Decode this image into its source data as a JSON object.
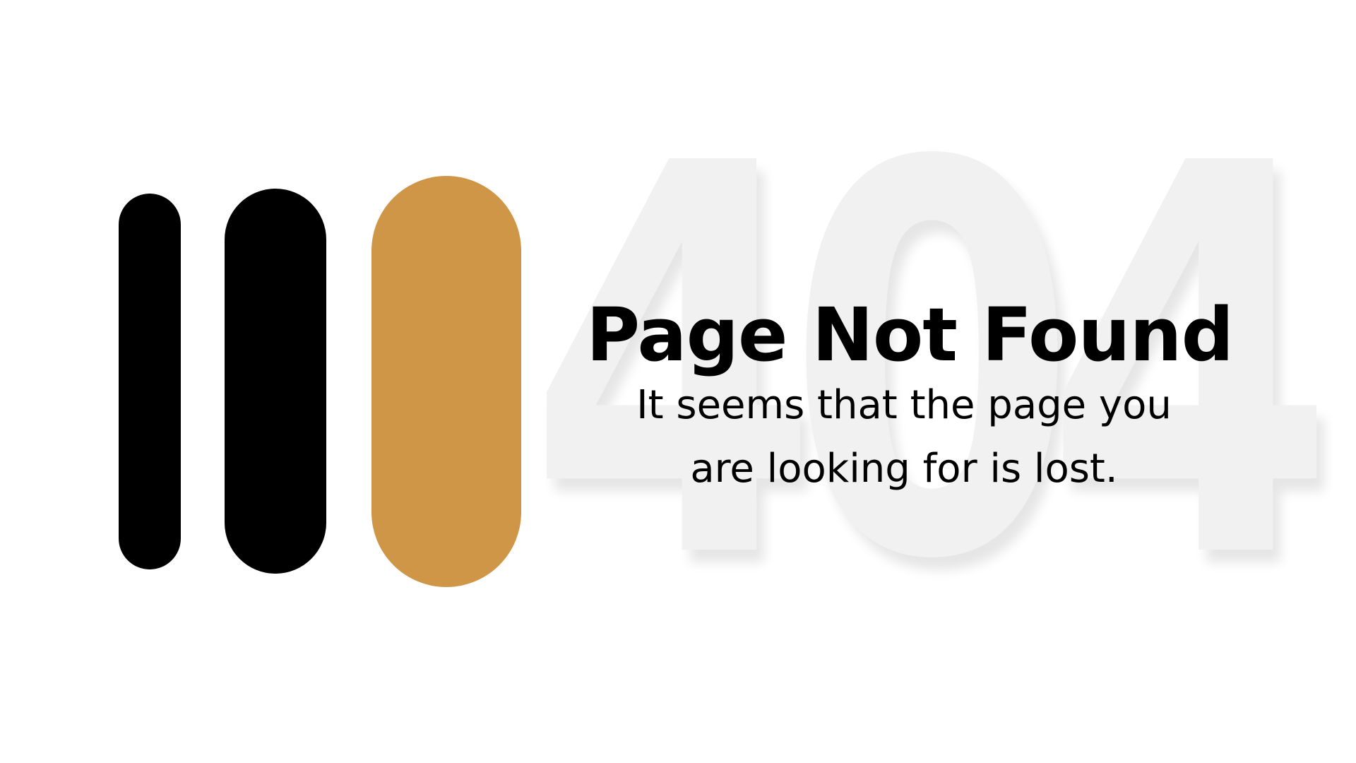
{
  "logo": {
    "pills": [
      {
        "color": "#000000"
      },
      {
        "color": "#000000"
      },
      {
        "color": "#cf9647"
      }
    ]
  },
  "background_code": "404",
  "main": {
    "title": "Page Not Found",
    "subtitle_line1": "It seems that the page you",
    "subtitle_line2": "are looking for is lost."
  },
  "colors": {
    "background": "#ffffff",
    "accent": "#cf9647",
    "text": "#000000",
    "watermark": "#f1f1f1"
  }
}
